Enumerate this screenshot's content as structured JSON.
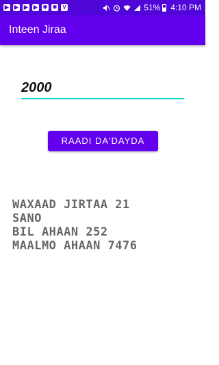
{
  "status_bar": {
    "battery": "51%",
    "time": "4:10 PM",
    "notification_icons": [
      "youtube-icon",
      "youtube-icon",
      "youtube-icon",
      "youtube-icon",
      "settings-icon",
      "settings-icon",
      "v-icon"
    ],
    "status_icons": [
      "mute-icon",
      "alarm-icon",
      "wifi-icon",
      "signal-icon"
    ]
  },
  "app_bar": {
    "title": "Inteen Jiraa"
  },
  "input": {
    "value": "2000"
  },
  "button": {
    "label": "RAADI DA'DAYDA"
  },
  "result": {
    "lines": [
      "WAXAAD JIRTAA 21",
      "SANO",
      "BIL AHAAN 252",
      "MAALMO AHAAN 7476"
    ]
  },
  "colors": {
    "primary": "#6200ee",
    "status_bar": "#5006d8",
    "accent": "#03dac5",
    "result_text": "#666666"
  }
}
